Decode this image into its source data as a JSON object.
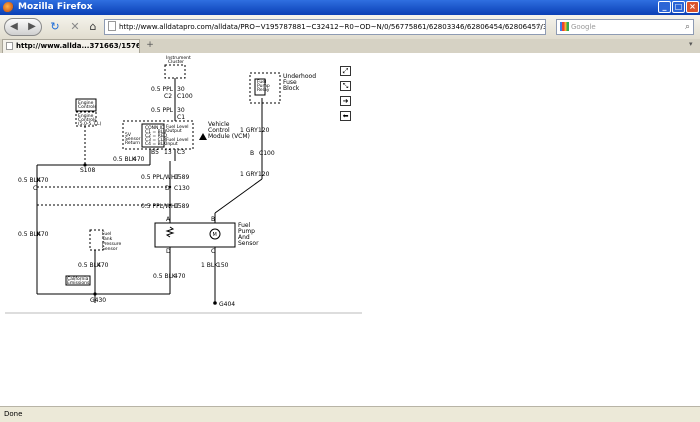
{
  "window": {
    "title": "Mozilla Firefox"
  },
  "nav": {
    "url": "http://www.alldatapro.com/alldata/PRO~V195787881~C32412~R0~OD~N/0/56775861/62803346/62806454/62806457/34653741/34857029/34060042/3",
    "search_placeholder": "Google"
  },
  "tab": {
    "label": "http://www.allda...371663/157696793"
  },
  "status": {
    "text": "Done"
  },
  "diagram": {
    "instrument_cluster": [
      "Instrument",
      "Cluster"
    ],
    "engine_controls_box": [
      "Engine",
      "Controls",
      "(P.C.)"
    ],
    "engine_controls_sub": [
      "Engine",
      "Controls",
      "(5.0-5.7 L)"
    ],
    "underhood_fuse_block": [
      "Underhood",
      "Fuse",
      "Block"
    ],
    "fuse_inner": [
      "Fuel",
      "Pump",
      "Relay"
    ],
    "vcm_label": [
      "Vehicle",
      "Control",
      "Module (VCM)"
    ],
    "vcm_inner": [
      "CONN ID",
      "C1 = BLU",
      "C2 = RED",
      "C3 = CLR",
      "C4 = BLK"
    ],
    "vcm_left": [
      "5V",
      "Sensor",
      "Return"
    ],
    "vcm_right_top": [
      "Fuel Level",
      "Output"
    ],
    "vcm_right_bottom": [
      "Fuel Level",
      "Input"
    ],
    "fuel_pump_label": [
      "Fuel",
      "Pump",
      "And",
      "Sensor"
    ],
    "ftp_sensor": [
      "Fuel",
      "Tank",
      "Pressure",
      "Sensor"
    ],
    "california_box": [
      "California",
      "Emissions"
    ],
    "wires": {
      "w30a": "0.5 PPL",
      "w30a_num": "30",
      "c2": "C2",
      "c100": "C100",
      "w30b": "0.5 PPL",
      "w30b_num": "30",
      "c1": "C1",
      "w30c": "0.5 PPL",
      "w30c_num": "30",
      "blk470_top": "0.5 BLK",
      "blk470_top_num": "470",
      "b5": "B5",
      "c3": "C3",
      "n13": "13",
      "s108": "S108",
      "blk470_left": "0.5 BLK",
      "blk470_left_num": "470",
      "pplwht1": "0.5 PPL/WHT",
      "pplwht1_num": "1589",
      "c130": "C130",
      "pplwht2": "0.5 PPL/WHT",
      "pplwht2_num": "1589",
      "blk470_mid": "0.5 BLK",
      "blk470_mid_num": "470",
      "blk470_sensor": "0.5 BLK",
      "blk470_sensor_num": "470",
      "blk470_bottom": "0.5 BLK",
      "blk470_bottom_num": "470",
      "g430": "G430",
      "gry120_top": "1 GRY",
      "gry120_top_num": "120",
      "b": "B",
      "c100b": "C100",
      "gry120_bot": "1 GRY",
      "gry120_bot_num": "120",
      "blk150": "1 BLK",
      "blk150_num": "150",
      "g404": "G404",
      "pin_a": "A",
      "pin_b": "B",
      "pin_c": "C",
      "pin_d": "D",
      "c_left": "C",
      "d_left": "D",
      "motor": "M"
    }
  }
}
